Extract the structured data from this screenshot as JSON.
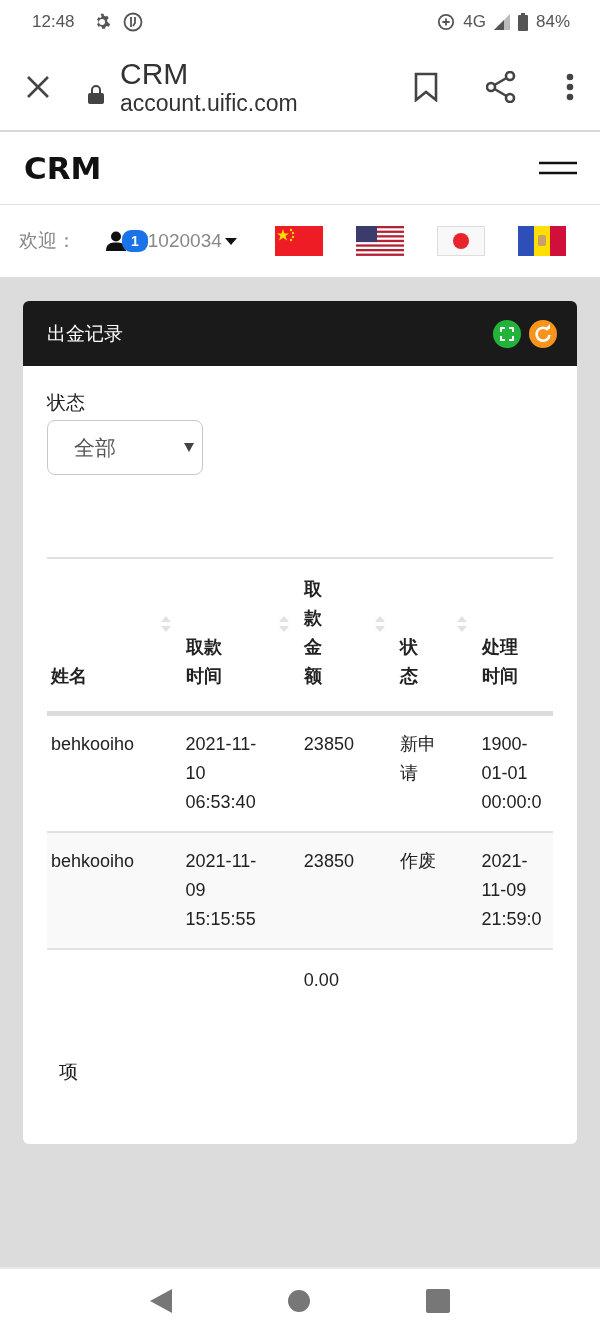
{
  "status_bar": {
    "time": "12:48",
    "network": "4G",
    "battery": "84%"
  },
  "browser": {
    "title": "CRM",
    "url": "account.uific.com"
  },
  "site": {
    "logo": "CRM"
  },
  "user_bar": {
    "welcome": "欢迎：",
    "badge": "1",
    "user_id": "1020034",
    "languages": [
      {
        "kind": "cn"
      },
      {
        "kind": "us"
      },
      {
        "kind": "jp"
      },
      {
        "kind": "ad"
      }
    ]
  },
  "panel": {
    "title": "出金记录",
    "filter": {
      "label": "状态",
      "value": "全部"
    },
    "table": {
      "columns": [
        {
          "label": "姓名",
          "sortable": true
        },
        {
          "label": "取款时间",
          "sortable": true
        },
        {
          "label": "取款金额",
          "sortable": true
        },
        {
          "label": "状态",
          "sortable": true
        },
        {
          "label": "处理时间",
          "sortable": false
        }
      ],
      "rows": [
        [
          "behkooiho",
          "2021-11-10 06:53:40",
          "23850",
          "新申请",
          "1900-01-01 00:00:0"
        ],
        [
          "behkooiho",
          "2021-11-09 15:15:55",
          "23850",
          "作废",
          "2021-11-09 21:59:0"
        ]
      ],
      "total_amount": "0.00"
    },
    "footer": "项"
  }
}
